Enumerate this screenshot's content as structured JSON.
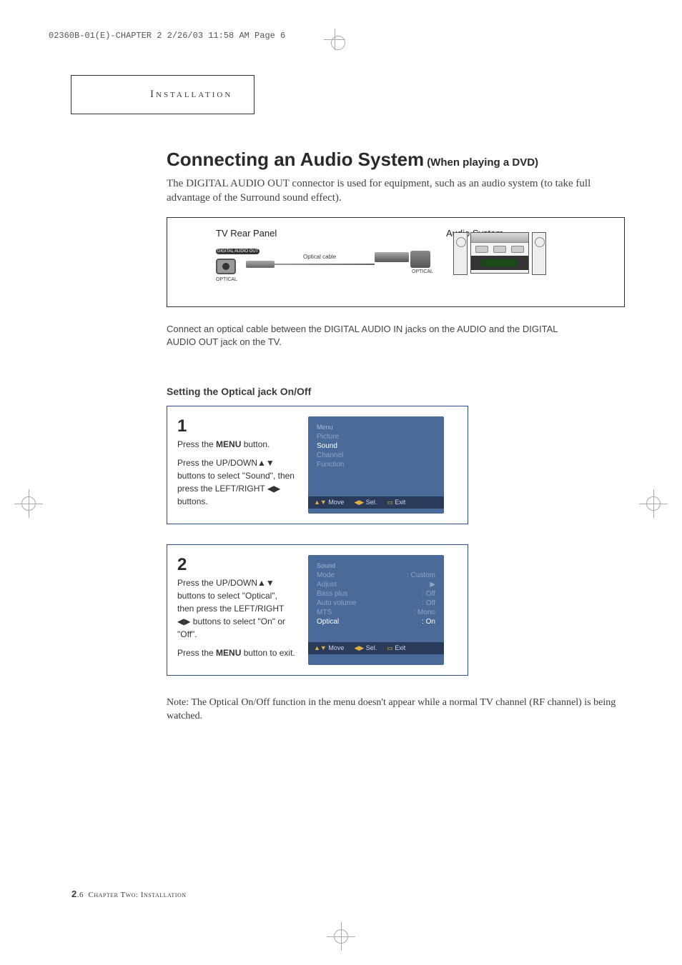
{
  "header_print": "02360B-01(E)-CHAPTER 2  2/26/03  11:58 AM  Page 6",
  "section_tab": "Installation",
  "title_main": "Connecting an Audio System",
  "title_sub": "(When playing a DVD)",
  "intro": "The DIGITAL AUDIO OUT connector is used for equipment, such as an audio system (to take full advantage of the Surround sound effect).",
  "diagram": {
    "tv_panel": "TV Rear Panel",
    "audio_system": "Audio System",
    "port_label": "DIGITAL AUDIO OUT",
    "port_text": "OPTICAL",
    "cable_label": "Optical cable",
    "receiver_port": "OPTICAL"
  },
  "connect_instruction": "Connect an optical cable between the DIGITAL AUDIO IN jacks on the AUDIO and the DIGITAL AUDIO OUT jack on the TV.",
  "subsection": "Setting the Optical jack On/Off",
  "step1": {
    "num": "1",
    "line1_pre": "Press the ",
    "line1_bold": "MENU",
    "line1_post": " button.",
    "line2": "Press the UP/DOWN▲▼ buttons to select \"Sound\", then press the LEFT/RIGHT ◀▶ buttons.",
    "osd_title": "Menu",
    "osd_items": [
      "Picture",
      "Sound",
      "Channel",
      "Function"
    ],
    "osd_active": "Sound",
    "footer_move": "Move",
    "footer_sel": "Sel.",
    "footer_exit": "Exit"
  },
  "step2": {
    "num": "2",
    "line1": "Press the UP/DOWN▲▼ buttons to select \"Optical\", then press the LEFT/RIGHT ◀▶ buttons to select \"On\" or \"Off\".",
    "line2_pre": "Press the ",
    "line2_bold": "MENU",
    "line2_post": " button to exit.",
    "osd_title": "Sound",
    "osd_rows": [
      {
        "label": "Mode",
        "value": ": Custom"
      },
      {
        "label": "Adjust",
        "value": "▶"
      },
      {
        "label": "Bass plus",
        "value": ": Off"
      },
      {
        "label": "Auto volume",
        "value": ": Off"
      },
      {
        "label": "MTS",
        "value": ": Mono"
      },
      {
        "label": "Optical",
        "value": ": On"
      }
    ],
    "osd_active": "Optical",
    "footer_move": "Move",
    "footer_sel": "Sel.",
    "footer_exit": "Exit"
  },
  "note": "Note: The Optical On/Off function in the menu doesn't appear while a normal TV channel (RF channel) is being watched.",
  "footer": {
    "page_major": "2",
    "page_minor": ".6",
    "chapter": "Chapter Two: Installation"
  }
}
